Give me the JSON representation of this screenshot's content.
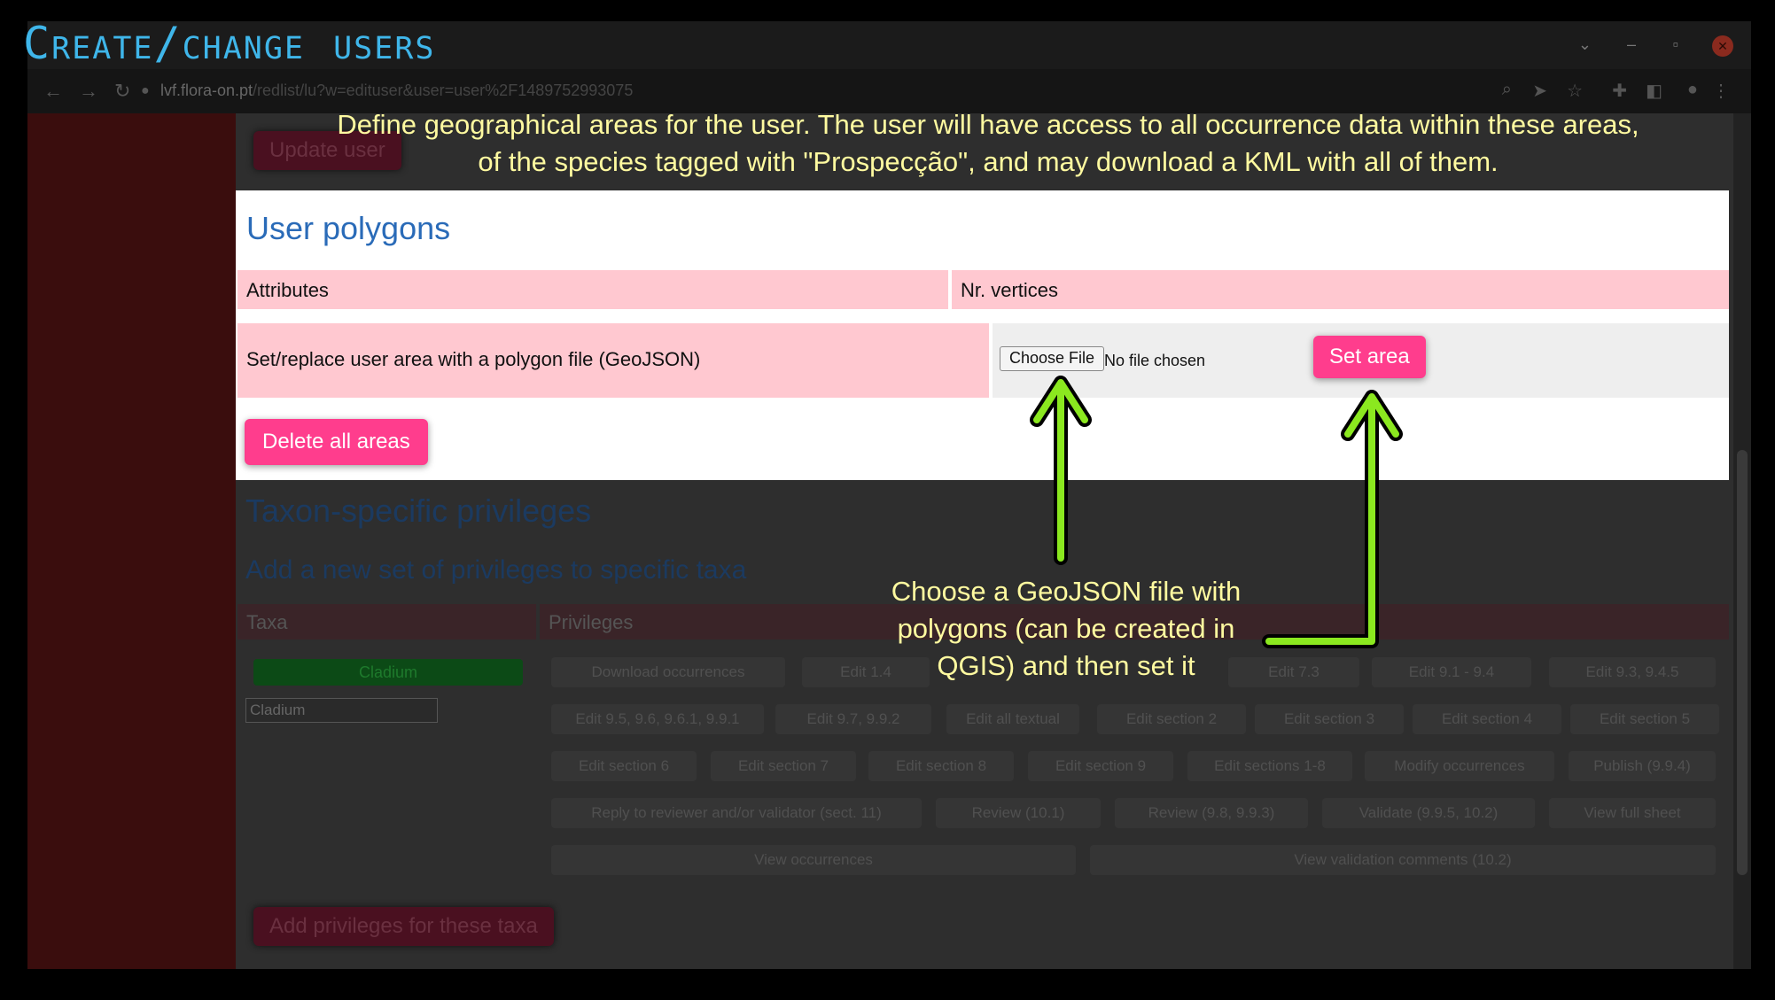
{
  "frame_title": "Create/change users",
  "browser": {
    "url_host": "lvf.flora-on.pt",
    "url_path": "/redlist/lu?w=edituser&user=user%2F1489752993075"
  },
  "buttons": {
    "update_user": "Update user",
    "add_privileges": "Add privileges for these taxa"
  },
  "captions": {
    "top": "Define geographical areas for the user. The user will have access to all occurrence data within these areas, of the species tagged with \"Prospecção\", and may download a KML with all of them.",
    "bottom": "Choose a GeoJSON file with polygons (can be created in QGIS) and then set it"
  },
  "user_polygons": {
    "title": "User polygons",
    "headers": [
      "Attributes",
      "Nr. vertices"
    ],
    "set_label": "Set/replace user area with a polygon file (GeoJSON)",
    "choose_file": "Choose File",
    "no_file": "No file chosen",
    "set_area": "Set area",
    "delete_all": "Delete all areas"
  },
  "taxon_privileges": {
    "title": "Taxon-specific privileges",
    "subtitle": "Add a new set of privileges to specific taxa",
    "headers": [
      "Taxa",
      "Privileges"
    ],
    "taxon_chip": "Cladium",
    "taxon_input": "Cladium",
    "privileges": [
      "Download occurrences",
      "Edit 1.4",
      "Edit 7.3",
      "Edit 9.1 - 9.4",
      "Edit 9.3, 9.4.5",
      "Edit 9.5, 9.6, 9.6.1, 9.9.1",
      "Edit 9.7, 9.9.2",
      "Edit all textual",
      "Edit section 2",
      "Edit section 3",
      "Edit section 4",
      "Edit section 5",
      "Edit section 6",
      "Edit section 7",
      "Edit section 8",
      "Edit section 9",
      "Edit sections 1-8",
      "Modify occurrences",
      "Publish (9.9.4)",
      "Reply to reviewer and/or validator (sect. 11)",
      "Review (10.1)",
      "Review (9.8, 9.9.3)",
      "Validate (9.9.5, 10.2)",
      "View full sheet",
      "View occurrences",
      "View validation comments (10.2)"
    ]
  },
  "colors": {
    "accent_pink": "#ff3d8d",
    "header_pink": "#ffc8d0",
    "arrow_green": "#8be81f",
    "caption_yellow": "#fffaa0",
    "title_blue": "#3fb6ea"
  }
}
